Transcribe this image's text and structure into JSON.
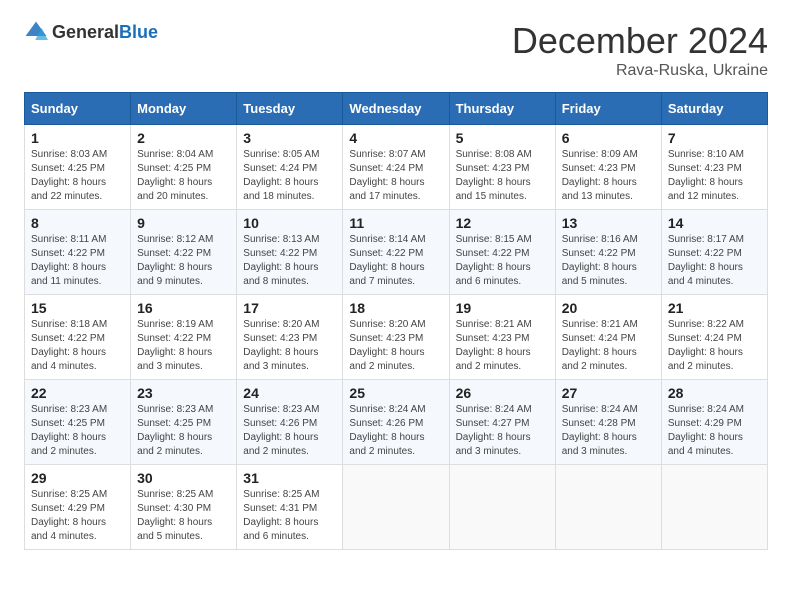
{
  "header": {
    "logo": {
      "general": "General",
      "blue": "Blue"
    },
    "title": "December 2024",
    "location": "Rava-Ruska, Ukraine"
  },
  "calendar": {
    "days_of_week": [
      "Sunday",
      "Monday",
      "Tuesday",
      "Wednesday",
      "Thursday",
      "Friday",
      "Saturday"
    ],
    "weeks": [
      [
        {
          "day": "1",
          "sunrise": "8:03 AM",
          "sunset": "4:25 PM",
          "daylight": "8 hours and 22 minutes."
        },
        {
          "day": "2",
          "sunrise": "8:04 AM",
          "sunset": "4:25 PM",
          "daylight": "8 hours and 20 minutes."
        },
        {
          "day": "3",
          "sunrise": "8:05 AM",
          "sunset": "4:24 PM",
          "daylight": "8 hours and 18 minutes."
        },
        {
          "day": "4",
          "sunrise": "8:07 AM",
          "sunset": "4:24 PM",
          "daylight": "8 hours and 17 minutes."
        },
        {
          "day": "5",
          "sunrise": "8:08 AM",
          "sunset": "4:23 PM",
          "daylight": "8 hours and 15 minutes."
        },
        {
          "day": "6",
          "sunrise": "8:09 AM",
          "sunset": "4:23 PM",
          "daylight": "8 hours and 13 minutes."
        },
        {
          "day": "7",
          "sunrise": "8:10 AM",
          "sunset": "4:23 PM",
          "daylight": "8 hours and 12 minutes."
        }
      ],
      [
        {
          "day": "8",
          "sunrise": "8:11 AM",
          "sunset": "4:22 PM",
          "daylight": "8 hours and 11 minutes."
        },
        {
          "day": "9",
          "sunrise": "8:12 AM",
          "sunset": "4:22 PM",
          "daylight": "8 hours and 9 minutes."
        },
        {
          "day": "10",
          "sunrise": "8:13 AM",
          "sunset": "4:22 PM",
          "daylight": "8 hours and 8 minutes."
        },
        {
          "day": "11",
          "sunrise": "8:14 AM",
          "sunset": "4:22 PM",
          "daylight": "8 hours and 7 minutes."
        },
        {
          "day": "12",
          "sunrise": "8:15 AM",
          "sunset": "4:22 PM",
          "daylight": "8 hours and 6 minutes."
        },
        {
          "day": "13",
          "sunrise": "8:16 AM",
          "sunset": "4:22 PM",
          "daylight": "8 hours and 5 minutes."
        },
        {
          "day": "14",
          "sunrise": "8:17 AM",
          "sunset": "4:22 PM",
          "daylight": "8 hours and 4 minutes."
        }
      ],
      [
        {
          "day": "15",
          "sunrise": "8:18 AM",
          "sunset": "4:22 PM",
          "daylight": "8 hours and 4 minutes."
        },
        {
          "day": "16",
          "sunrise": "8:19 AM",
          "sunset": "4:22 PM",
          "daylight": "8 hours and 3 minutes."
        },
        {
          "day": "17",
          "sunrise": "8:20 AM",
          "sunset": "4:23 PM",
          "daylight": "8 hours and 3 minutes."
        },
        {
          "day": "18",
          "sunrise": "8:20 AM",
          "sunset": "4:23 PM",
          "daylight": "8 hours and 2 minutes."
        },
        {
          "day": "19",
          "sunrise": "8:21 AM",
          "sunset": "4:23 PM",
          "daylight": "8 hours and 2 minutes."
        },
        {
          "day": "20",
          "sunrise": "8:21 AM",
          "sunset": "4:24 PM",
          "daylight": "8 hours and 2 minutes."
        },
        {
          "day": "21",
          "sunrise": "8:22 AM",
          "sunset": "4:24 PM",
          "daylight": "8 hours and 2 minutes."
        }
      ],
      [
        {
          "day": "22",
          "sunrise": "8:23 AM",
          "sunset": "4:25 PM",
          "daylight": "8 hours and 2 minutes."
        },
        {
          "day": "23",
          "sunrise": "8:23 AM",
          "sunset": "4:25 PM",
          "daylight": "8 hours and 2 minutes."
        },
        {
          "day": "24",
          "sunrise": "8:23 AM",
          "sunset": "4:26 PM",
          "daylight": "8 hours and 2 minutes."
        },
        {
          "day": "25",
          "sunrise": "8:24 AM",
          "sunset": "4:26 PM",
          "daylight": "8 hours and 2 minutes."
        },
        {
          "day": "26",
          "sunrise": "8:24 AM",
          "sunset": "4:27 PM",
          "daylight": "8 hours and 3 minutes."
        },
        {
          "day": "27",
          "sunrise": "8:24 AM",
          "sunset": "4:28 PM",
          "daylight": "8 hours and 3 minutes."
        },
        {
          "day": "28",
          "sunrise": "8:24 AM",
          "sunset": "4:29 PM",
          "daylight": "8 hours and 4 minutes."
        }
      ],
      [
        {
          "day": "29",
          "sunrise": "8:25 AM",
          "sunset": "4:29 PM",
          "daylight": "8 hours and 4 minutes."
        },
        {
          "day": "30",
          "sunrise": "8:25 AM",
          "sunset": "4:30 PM",
          "daylight": "8 hours and 5 minutes."
        },
        {
          "day": "31",
          "sunrise": "8:25 AM",
          "sunset": "4:31 PM",
          "daylight": "8 hours and 6 minutes."
        },
        null,
        null,
        null,
        null
      ]
    ]
  }
}
